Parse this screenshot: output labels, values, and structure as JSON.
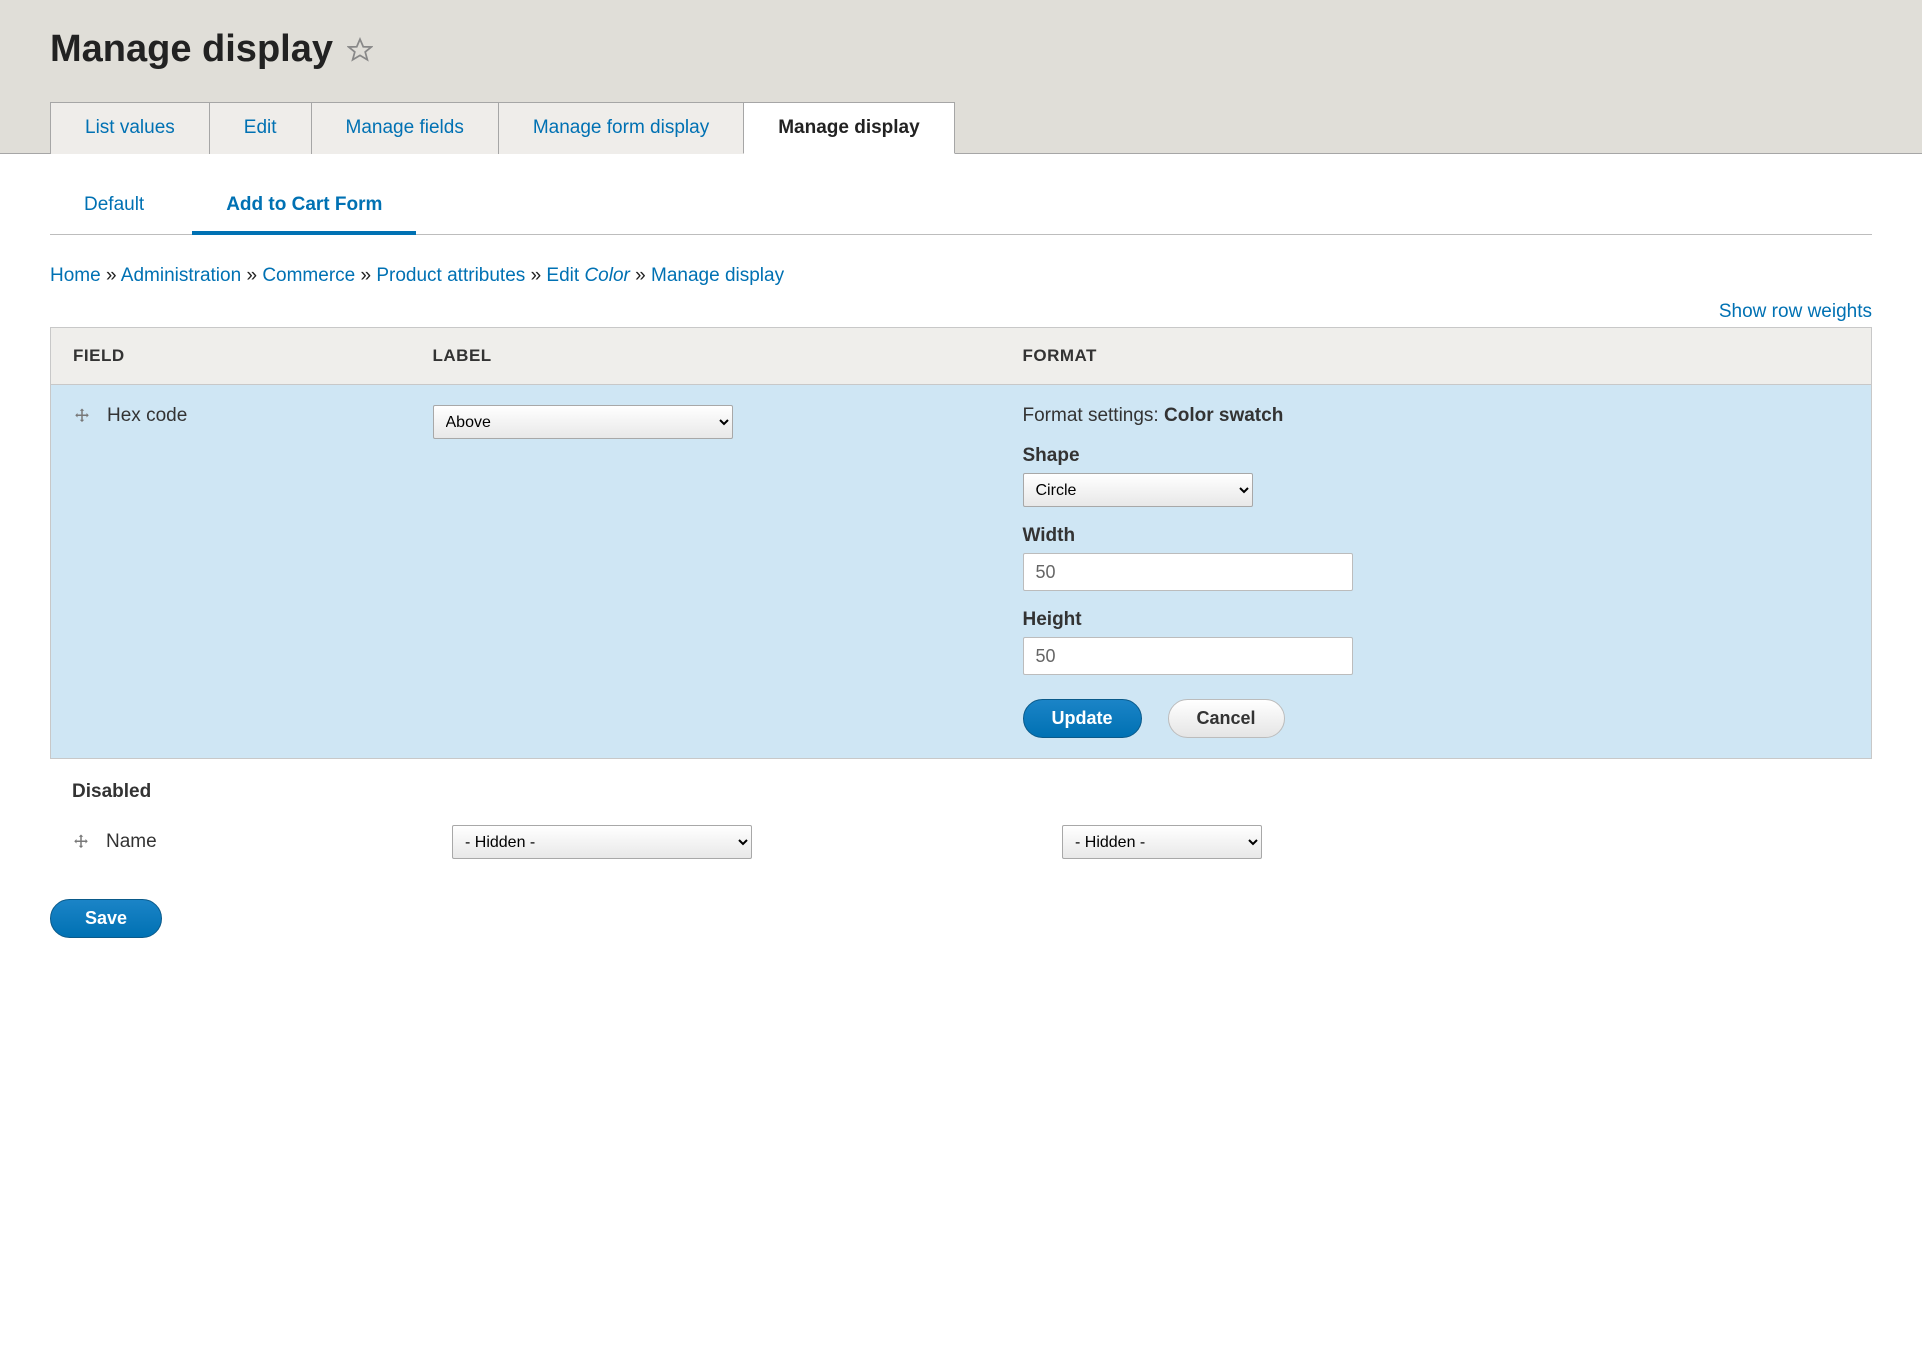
{
  "page": {
    "title": "Manage display"
  },
  "primary_tabs": {
    "list_values": "List values",
    "edit": "Edit",
    "manage_fields": "Manage fields",
    "manage_form_display": "Manage form display",
    "manage_display": "Manage display"
  },
  "secondary_tabs": {
    "default": "Default",
    "add_to_cart": "Add to Cart Form"
  },
  "breadcrumb": {
    "home": "Home",
    "administration": "Administration",
    "commerce": "Commerce",
    "product_attributes": "Product attributes",
    "edit_label": "Edit",
    "edit_attr": "Color",
    "manage_display": "Manage display",
    "sep": "»"
  },
  "links": {
    "show_row_weights": "Show row weights"
  },
  "table": {
    "headers": {
      "field": "FIELD",
      "label": "LABEL",
      "format": "FORMAT"
    },
    "row_hex": {
      "field_name": "Hex code",
      "label_select": "Above",
      "format_prefix": "Format settings:",
      "format_name": "Color swatch",
      "shape_label": "Shape",
      "shape_value": "Circle",
      "width_label": "Width",
      "width_value": "50",
      "height_label": "Height",
      "height_value": "50",
      "update_btn": "Update",
      "cancel_btn": "Cancel"
    },
    "disabled_heading": "Disabled",
    "row_name": {
      "field_name": "Name",
      "label_select": "- Hidden -",
      "format_select": "- Hidden -"
    }
  },
  "actions": {
    "save": "Save"
  }
}
